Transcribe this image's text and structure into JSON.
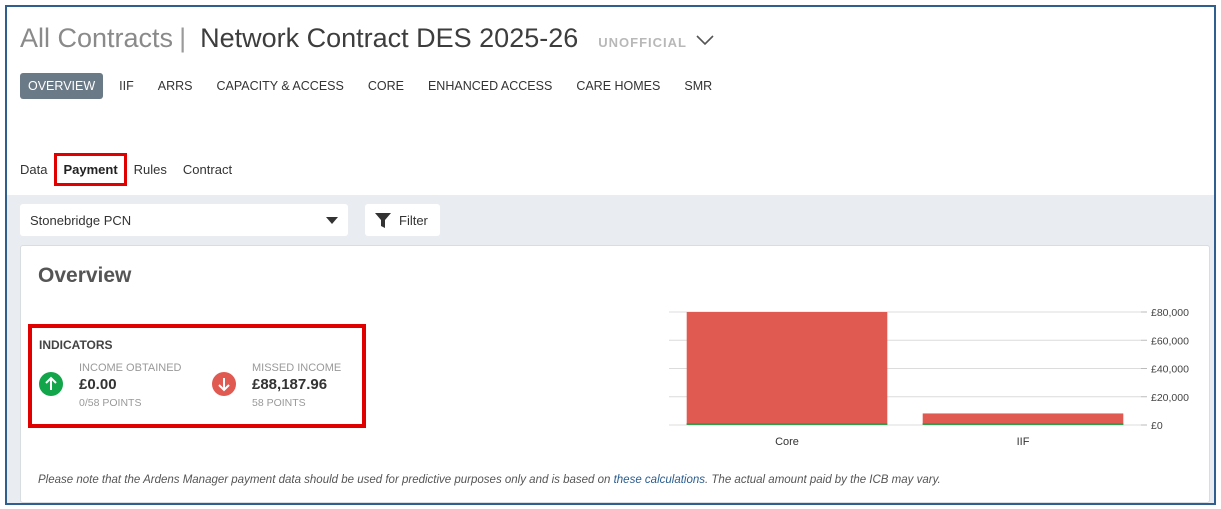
{
  "header": {
    "breadcrumb": "All Contracts",
    "separator": "|",
    "title": "Network Contract DES 2025-26",
    "status": "UNOFFICIAL"
  },
  "main_tabs": [
    {
      "label": "OVERVIEW",
      "active": true
    },
    {
      "label": "IIF"
    },
    {
      "label": "ARRS"
    },
    {
      "label": "CAPACITY & ACCESS"
    },
    {
      "label": "CORE"
    },
    {
      "label": "ENHANCED ACCESS"
    },
    {
      "label": "CARE HOMES"
    },
    {
      "label": "SMR"
    }
  ],
  "sub_tabs": [
    {
      "label": "Data"
    },
    {
      "label": "Payment",
      "active": true
    },
    {
      "label": "Rules"
    },
    {
      "label": "Contract"
    }
  ],
  "toolbar": {
    "pcn_selected": "Stonebridge PCN",
    "filter_label": "Filter"
  },
  "overview": {
    "title": "Overview",
    "indicators_title": "INDICATORS",
    "income_obtained": {
      "label": "INCOME OBTAINED",
      "value": "£0.00",
      "sub": "0/58 POINTS"
    },
    "missed_income": {
      "label": "MISSED INCOME",
      "value": "£88,187.96",
      "sub": "58 POINTS"
    }
  },
  "note": {
    "before": "Please note that the Ardens Manager payment data should be used for predictive purposes only and is based on ",
    "link": "these calculations",
    "after": ". The actual amount paid by the ICB may vary."
  },
  "colors": {
    "accent_tab": "#6a7a87",
    "missed": "#e05a52",
    "obtained": "#2e9e4f",
    "highlight": "#e00000"
  },
  "chart_data": {
    "type": "bar",
    "stacked": true,
    "categories": [
      "Core",
      "IIF"
    ],
    "series": [
      {
        "values": [
          0,
          0
        ],
        "color": "#2e9e4f"
      },
      {
        "values": [
          80000,
          8188
        ],
        "color": "#e05a52"
      }
    ],
    "y_ticks": [
      "£0",
      "£20,000",
      "£40,000",
      "£60,000",
      "£80,000"
    ],
    "ylim": [
      0,
      80000
    ],
    "grid": true,
    "y_axis_side": "right"
  }
}
